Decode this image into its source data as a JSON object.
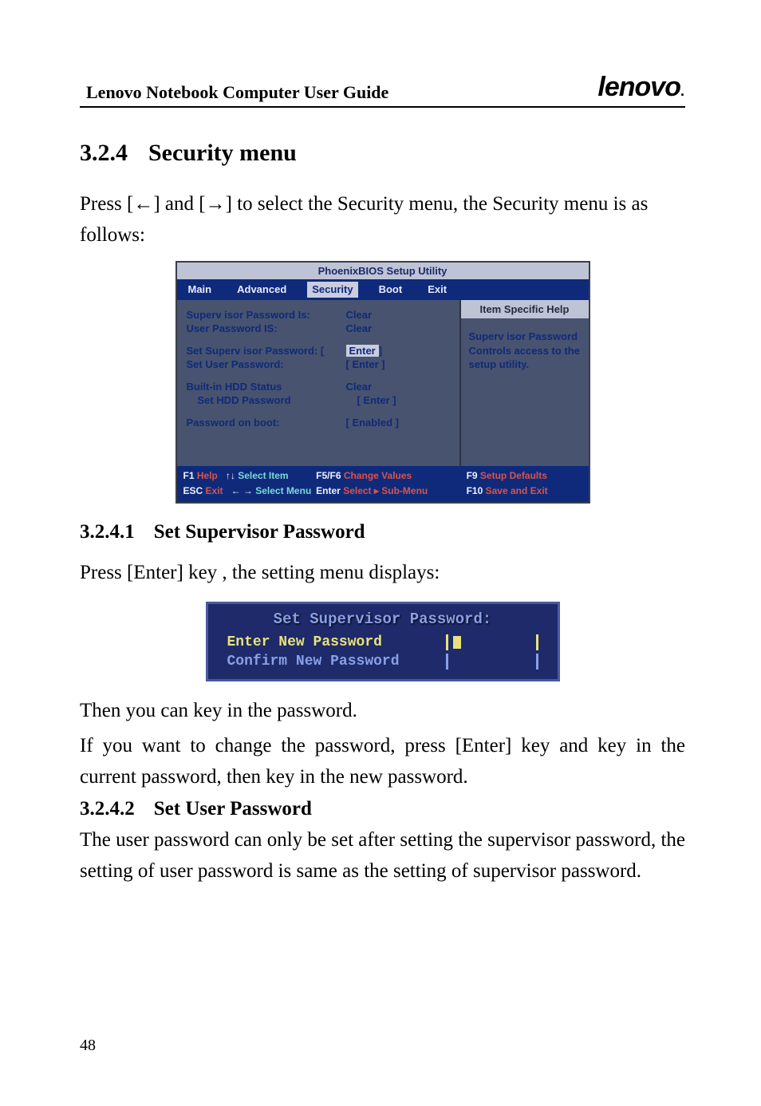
{
  "header": {
    "title": "Lenovo Notebook Computer User Guide",
    "brand": "lenovo",
    "brand_dot": "."
  },
  "section": {
    "number": "3.2.4",
    "title": "Security menu",
    "intro": "Press [←] and [→] to select the Security menu, the Security menu is as follows:"
  },
  "bios": {
    "utility_title": "PhoenixBIOS Setup Utility",
    "tabs": {
      "main": "Main",
      "advanced": "Advanced",
      "security": "Security",
      "boot": "Boot",
      "exit": "Exit"
    },
    "rows": {
      "sup_pw_is_label": "Superv isor  Password Is:",
      "sup_pw_is_value": "Clear",
      "user_pw_is_label": "User Password IS:",
      "user_pw_is_value": "Clear",
      "set_sup_pw_label": "Set Superv isor  Password: [",
      "set_sup_pw_value": "Enter",
      "set_sup_pw_close": "]",
      "set_user_pw_label": "Set User Password:",
      "set_user_pw_value": "[ Enter ]",
      "hdd_status_label": "Built-in HDD Status",
      "hdd_status_value": "Clear",
      "set_hdd_pw_label": "Set HDD Password",
      "set_hdd_pw_value": "[ Enter ]",
      "pw_on_boot_label": "Password on boot:",
      "pw_on_boot_value": "[ Enabled ]"
    },
    "help": {
      "header": "Item Specific Help",
      "line1": "Superv isor  Password",
      "line2": "Controls access to the",
      "line3": "setup utility."
    },
    "footer": {
      "f1": "F1",
      "help": "Help",
      "updown": "↑↓",
      "select_item": "Select Item",
      "f5f6": "F5/F6",
      "change_values": "Change Values",
      "f9": "F9",
      "setup_defaults": "Setup Defaults",
      "esc": "ESC",
      "exit": "Exit",
      "lr": "← →",
      "select_menu": "Select Menu",
      "enter": "Enter",
      "select_sub": "Select ▸ Sub-Menu",
      "f10": "F10",
      "save_exit": "Save and Exit"
    }
  },
  "sub1": {
    "number": "3.2.4.1",
    "title": "Set Supervisor Password",
    "p1": "Press [Enter] key , the setting menu displays:"
  },
  "pw_dialog": {
    "title": "Set Supervisor Password:",
    "enter_new": "Enter New Password",
    "confirm_new": "Confirm New Password"
  },
  "after_pw": {
    "p1": "Then you can key in the password.",
    "p2": "If you want to change the password, press [Enter] key and key in the current password, then key in the new password."
  },
  "sub2": {
    "number": "3.2.4.2",
    "title": "Set User Password",
    "p1": "The user password can only be set after setting the supervisor password, the setting of user password is same as the setting of supervisor password."
  },
  "page_number": "48"
}
